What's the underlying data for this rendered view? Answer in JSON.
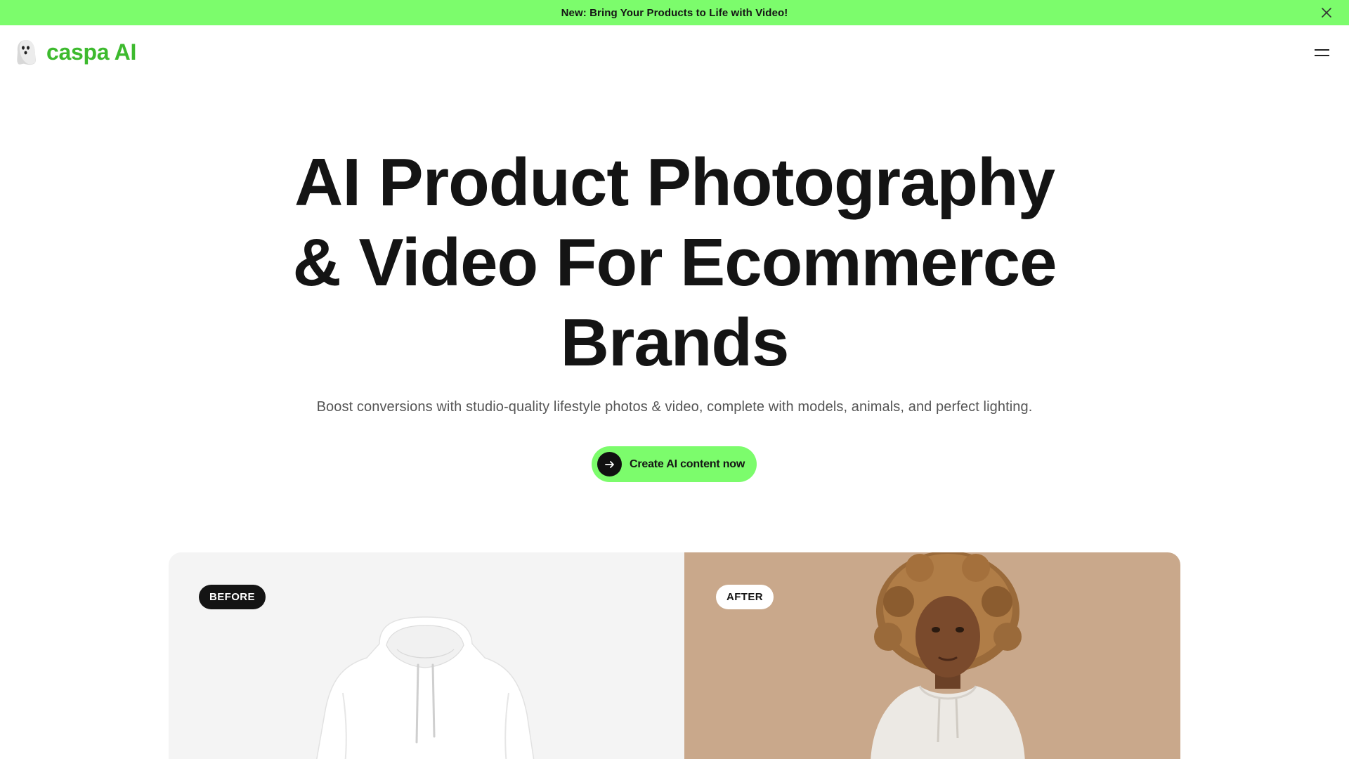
{
  "announcement": {
    "text": "New: Bring Your Products to Life with Video!",
    "close_icon": "close-icon"
  },
  "nav": {
    "brand": "caspa AI",
    "logo_icon": "ghost-icon",
    "menu_icon": "hamburger-menu-icon"
  },
  "hero": {
    "title_lines": [
      "AI Product Photography",
      "& Video For Ecommerce",
      "Brands"
    ],
    "subtitle": "Boost conversions with studio-quality lifestyle photos & video, complete with models, animals, and perfect lighting.",
    "cta_label": "Create AI content now",
    "cta_icon": "arrow-right-icon"
  },
  "comparison": {
    "before_label": "BEFORE",
    "after_label": "AFTER"
  },
  "colors": {
    "accent_green": "#7cfc6c",
    "brand_green": "#3dba2e",
    "text_dark": "#141414",
    "after_background": "#c9a88b"
  }
}
